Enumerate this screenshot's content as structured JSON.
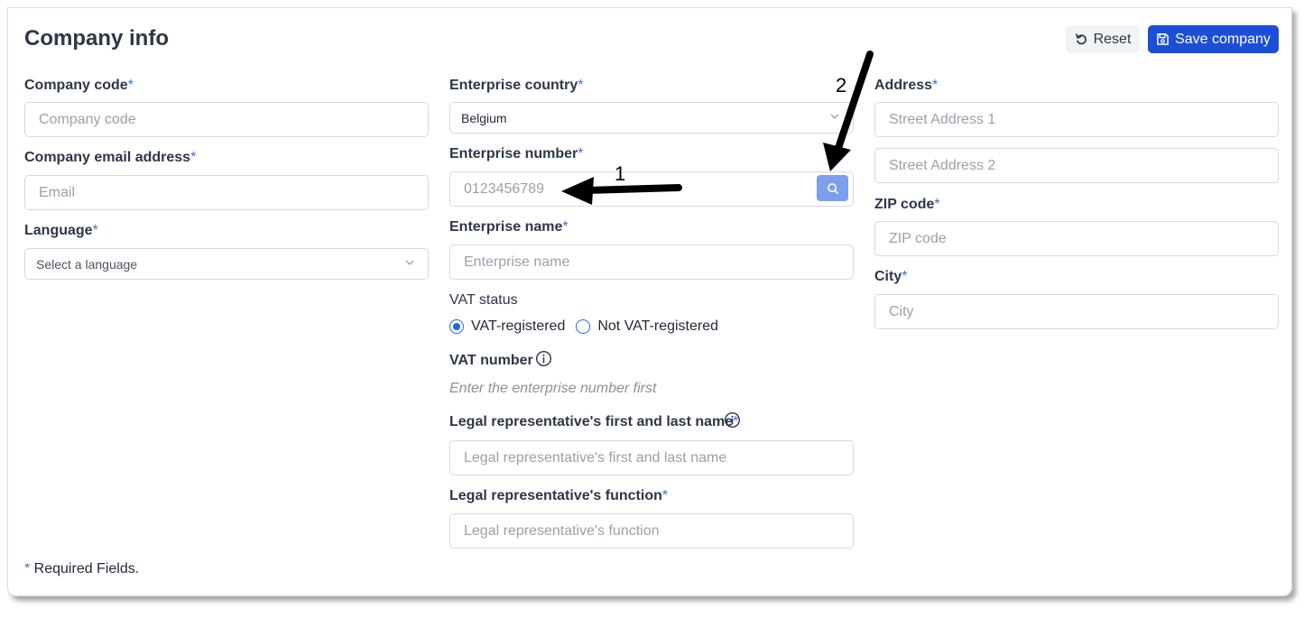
{
  "header": {
    "title": "Company info",
    "reset_label": "Reset",
    "save_label": "Save company"
  },
  "required_marker": "*",
  "left": {
    "company_code": {
      "label": "Company code",
      "placeholder": "Company code"
    },
    "email": {
      "label": "Company email address",
      "placeholder": "Email"
    },
    "language": {
      "label": "Language",
      "value": "Select a language"
    }
  },
  "middle": {
    "country": {
      "label": "Enterprise country",
      "value": "Belgium"
    },
    "enterprise_number": {
      "label": "Enterprise number",
      "placeholder": "0123456789"
    },
    "enterprise_name": {
      "label": "Enterprise name",
      "placeholder": "Enterprise name"
    },
    "vat_status": {
      "label": "VAT status",
      "options": [
        "VAT-registered",
        "Not VAT-registered"
      ],
      "selected": "VAT-registered"
    },
    "vat_number": {
      "label": "VAT number",
      "hint": "Enter the enterprise number first"
    },
    "legal_rep_name": {
      "label": "Legal representative's first and last name",
      "placeholder": "Legal representative's first and last name"
    },
    "legal_rep_function": {
      "label": "Legal representative's function",
      "placeholder": "Legal representative's function"
    }
  },
  "right": {
    "address": {
      "label": "Address",
      "placeholder1": "Street Address 1",
      "placeholder2": "Street Address 2"
    },
    "zip": {
      "label": "ZIP code",
      "placeholder": "ZIP code"
    },
    "city": {
      "label": "City",
      "placeholder": "City"
    }
  },
  "footer": {
    "marker": "*",
    "text": " Required Fields."
  },
  "annotations": {
    "arrow1": "1",
    "arrow2": "2"
  },
  "colors": {
    "primary": "#1d4ed8",
    "required": "#3b6fe0",
    "search_button": "#7da0ec"
  }
}
